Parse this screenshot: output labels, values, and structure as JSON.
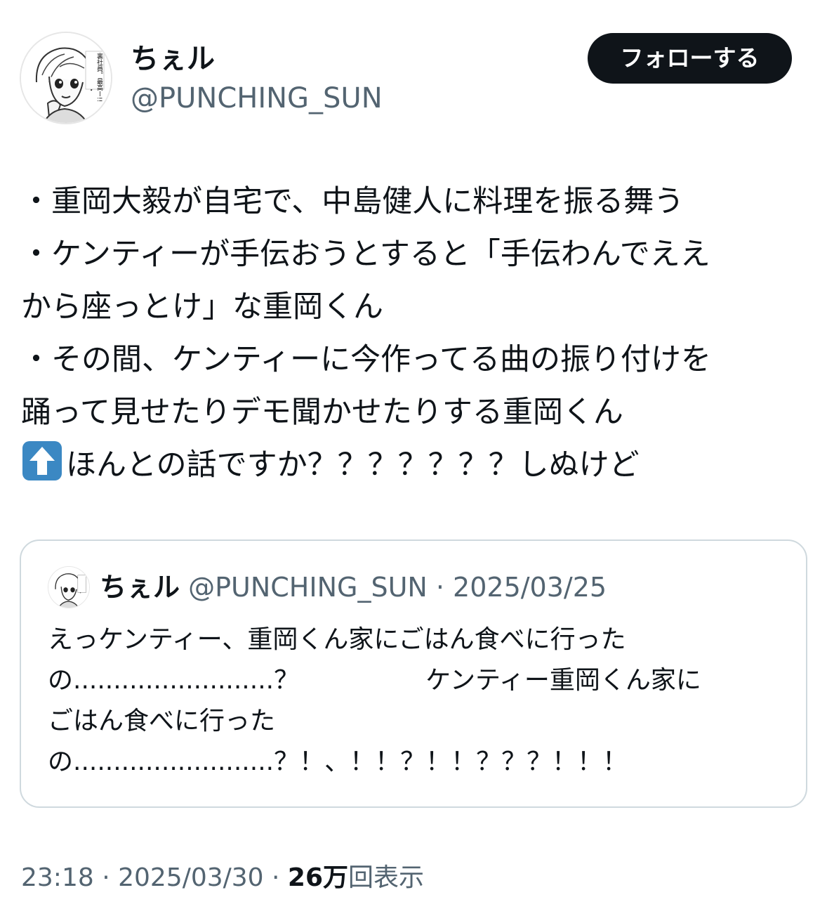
{
  "author": {
    "display_name": "ちぇル",
    "handle": "@PUNCHING_SUN",
    "avatar_caption": "裏社員。最高ー!!"
  },
  "follow_button": {
    "label": "フォローする"
  },
  "body": {
    "lines": [
      "・重岡大毅が自宅で、中島健人に料理を振る舞う",
      "・ケンティーが手伝おうとすると「手伝わんでええ",
      "から座っとけ」な重岡くん",
      "・その間、ケンティーに今作ってる曲の振り付けを",
      "踊って見せたりデモ聞かせたりする重岡くん"
    ],
    "last_line_text": "ほんとの話ですか？？？？？？？しぬけど",
    "last_line_icon": "up-arrow-emoji"
  },
  "quote": {
    "display_name": "ちぇル",
    "meta": "@PUNCHING_SUN · 2025/03/25",
    "lines": [
      "えっケンティー、重岡くん家にごはん食べに行った",
      "の.........................？　　　　　ケンティー重岡くん家に",
      "ごはん食べに行った",
      "の.........................？！、！！？！！？？？！！！"
    ]
  },
  "footer": {
    "time_date": "23:18 · 2025/03/30 · ",
    "views_count": "26万",
    "views_label": "回表示"
  },
  "colors": {
    "text": "#0f1419",
    "secondary": "#536471",
    "border": "#cfd9de",
    "button_bg": "#0f1419",
    "arrow_emoji_blue": "#3b88c3"
  }
}
